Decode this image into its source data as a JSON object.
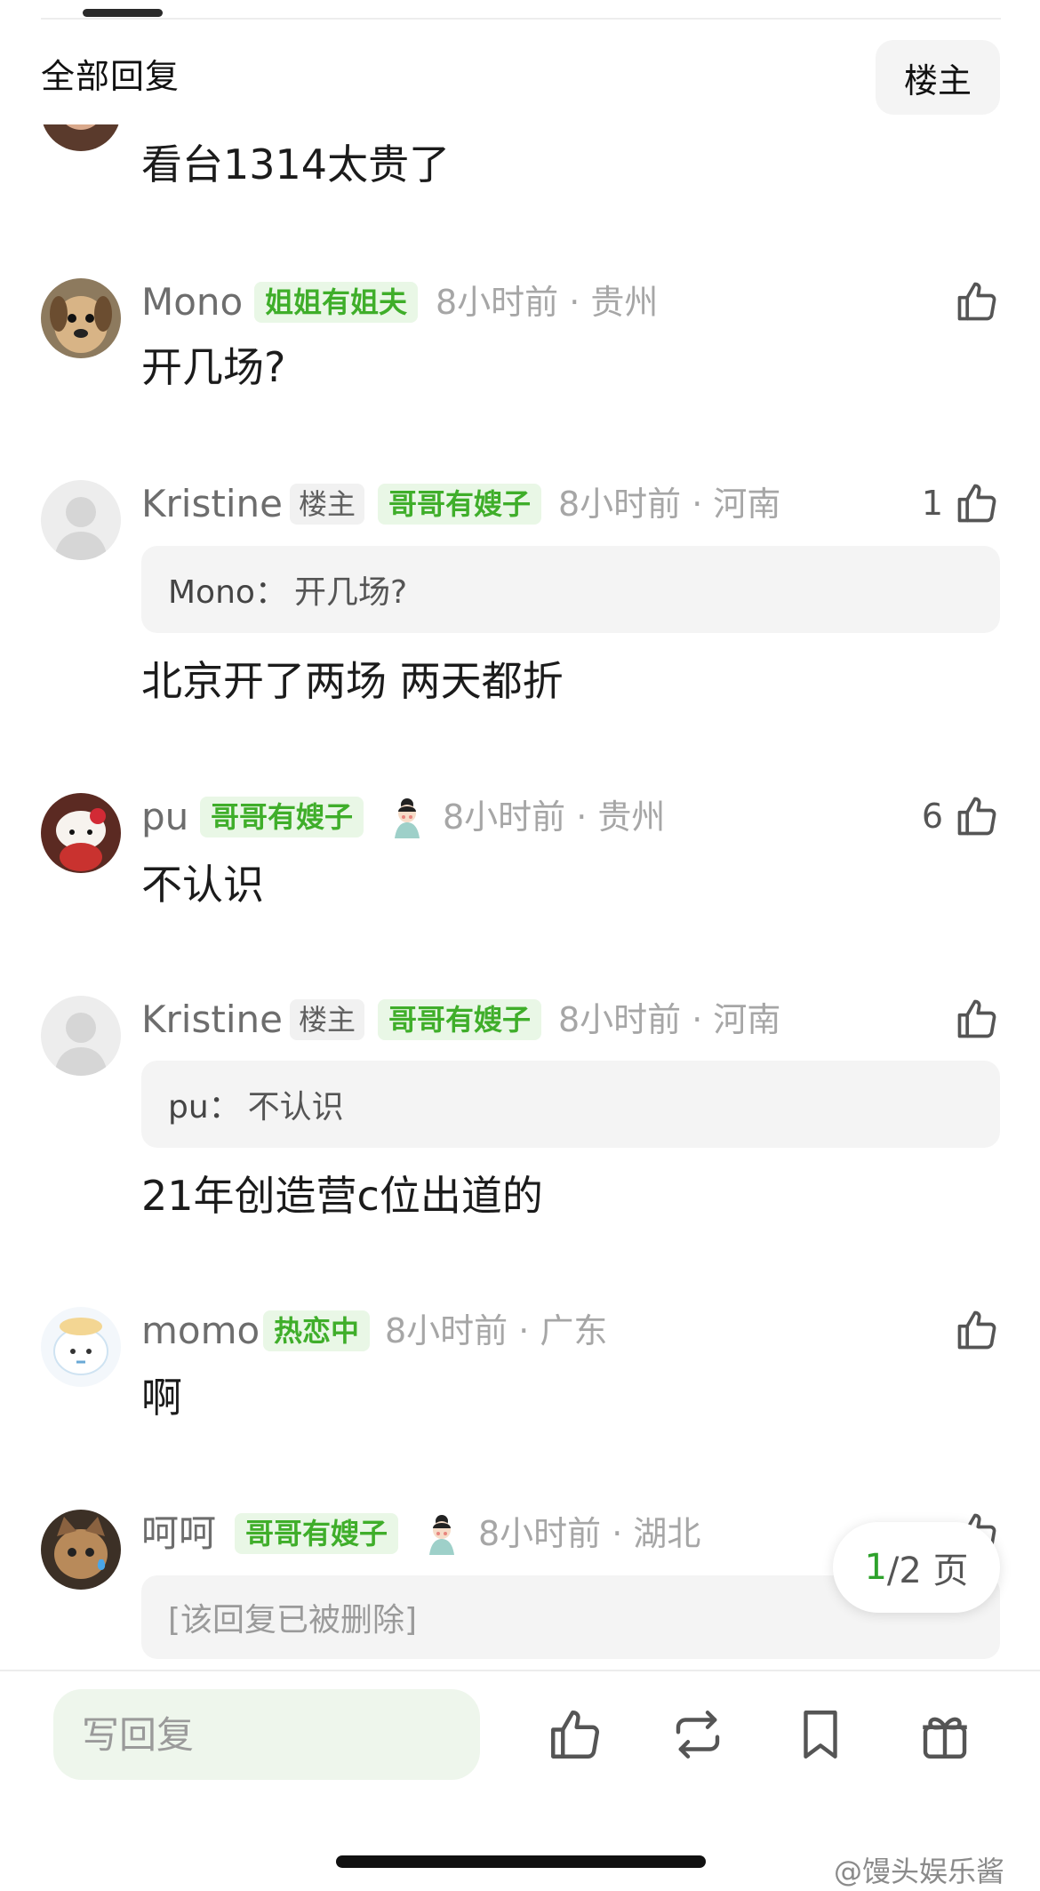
{
  "header": {
    "section_title": "全部回复",
    "owner_filter_label": "楼主"
  },
  "comments": [
    {
      "content": "看台1314太贵了"
    },
    {
      "username": "Mono",
      "badge": "姐姐有姐夫",
      "meta": "8小时前 · 贵州",
      "content": "开几场?",
      "avatar_icon": "puppy-avatar"
    },
    {
      "username": "Kristine",
      "owner_badge": "楼主",
      "badge": "哥哥有嫂子",
      "meta": "8小时前 · 河南",
      "likes": "1",
      "quote_user": "Mono：",
      "quote_text": "开几场?",
      "content": "北京开了两场 两天都折",
      "avatar_icon": "default-person-avatar"
    },
    {
      "username": "pu",
      "badge": "哥哥有嫂子",
      "meta": "8小时前 · 贵州",
      "likes": "6",
      "content": "不认识",
      "avatar_icon": "hello-kitty-avatar",
      "extra_icon": "girl-figure-icon"
    },
    {
      "username": "Kristine",
      "owner_badge": "楼主",
      "badge": "哥哥有嫂子",
      "meta": "8小时前 · 河南",
      "quote_user": "pu：",
      "quote_text": "不认识",
      "content": "21年创造营c位出道的",
      "avatar_icon": "default-person-avatar"
    },
    {
      "username": "momo",
      "badge": "热恋中",
      "meta": "8小时前 · 广东",
      "content": "啊",
      "avatar_icon": "cartoon-avatar"
    },
    {
      "username": "呵呵",
      "badge": "哥哥有嫂子",
      "meta": "8小时前 · 湖北",
      "deleted_text": "[该回复已被删除]",
      "avatar_icon": "cat-avatar",
      "extra_icon": "girl-figure-icon"
    }
  ],
  "pager": {
    "current": "1",
    "total": "/2 页"
  },
  "bottom_bar": {
    "reply_placeholder": "写回复",
    "icons": [
      "thumb-up-icon",
      "repost-icon",
      "bookmark-icon",
      "gift-icon"
    ]
  },
  "watermark": "@馒头娱乐酱",
  "colors": {
    "accent_green": "#3fae2a",
    "badge_bg": "#e9f7e6",
    "meta_gray": "#a6a6a6"
  }
}
